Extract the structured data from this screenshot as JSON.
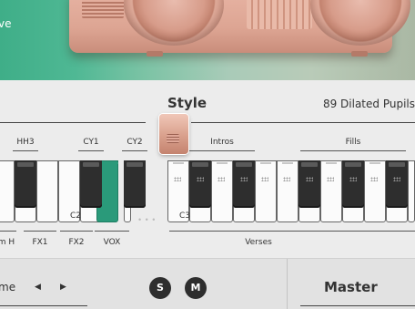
{
  "hero": {
    "label": "ve"
  },
  "header": {
    "title": "Style",
    "preset": "89 Dilated Pupils"
  },
  "keyboard": {
    "group_labels": [
      "HH3",
      "CY1",
      "CY2",
      "Intros",
      "Fills",
      "m H",
      "FX1",
      "FX2",
      "VOX",
      "Verses"
    ],
    "note_labels": [
      "C2",
      "C3"
    ],
    "ellipsis": "• • •"
  },
  "bottom": {
    "name_text": "me",
    "prev": "◀",
    "next": "▶",
    "solo": "S",
    "mute": "M",
    "master": "Master"
  },
  "colors": {
    "accent": "#2a9a7a",
    "black_key": "#2e2e2e"
  }
}
